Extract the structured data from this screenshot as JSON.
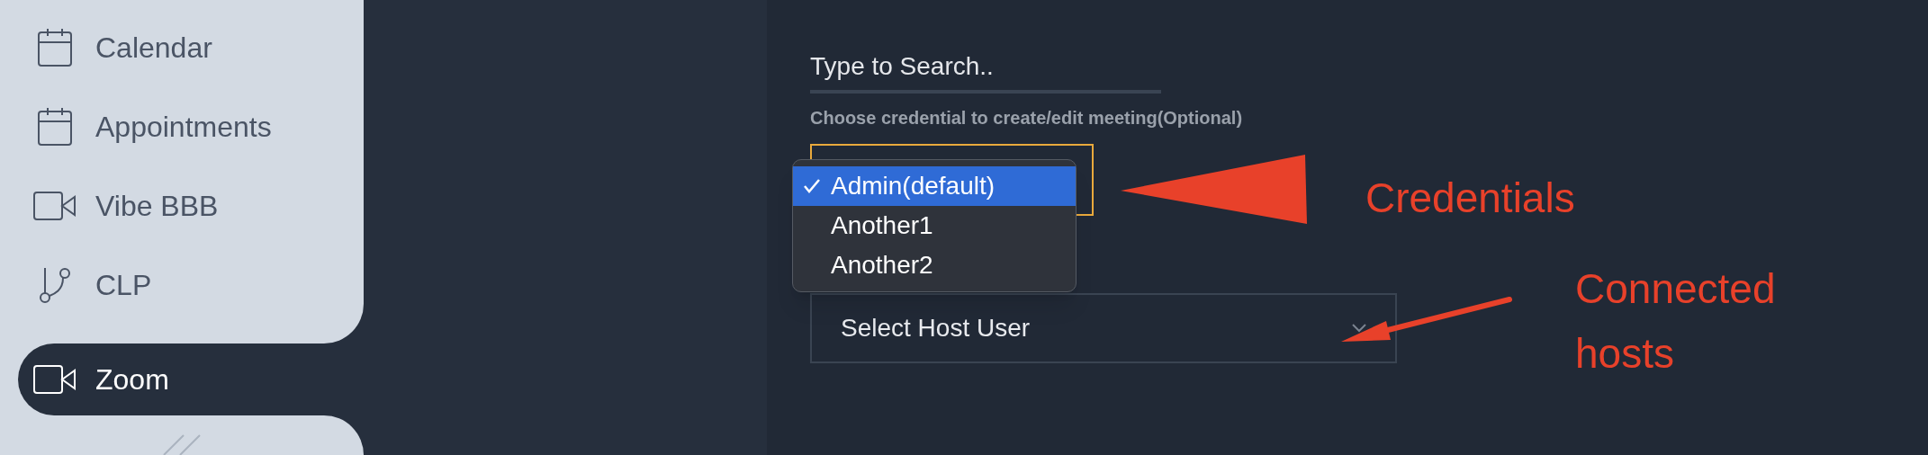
{
  "sidebar": {
    "items": [
      {
        "label": "Calendar",
        "kind": "calendar",
        "selected": false
      },
      {
        "label": "Appointments",
        "kind": "calendar",
        "selected": false
      },
      {
        "label": "Vibe BBB",
        "kind": "video",
        "selected": false
      },
      {
        "label": "CLP",
        "kind": "path",
        "selected": false
      },
      {
        "label": "Zoom",
        "kind": "video",
        "selected": true
      }
    ]
  },
  "search": {
    "placeholder": "Type to Search.."
  },
  "credential": {
    "label": "Choose credential to create/edit meeting(Optional)",
    "options": [
      {
        "label": "Admin(default)",
        "selected": true
      },
      {
        "label": "Another1",
        "selected": false
      },
      {
        "label": "Another2",
        "selected": false
      }
    ]
  },
  "host_select": {
    "placeholder": "Select Host User"
  },
  "annotations": [
    {
      "text": "Credentials"
    },
    {
      "text": "Connected hosts"
    }
  ]
}
